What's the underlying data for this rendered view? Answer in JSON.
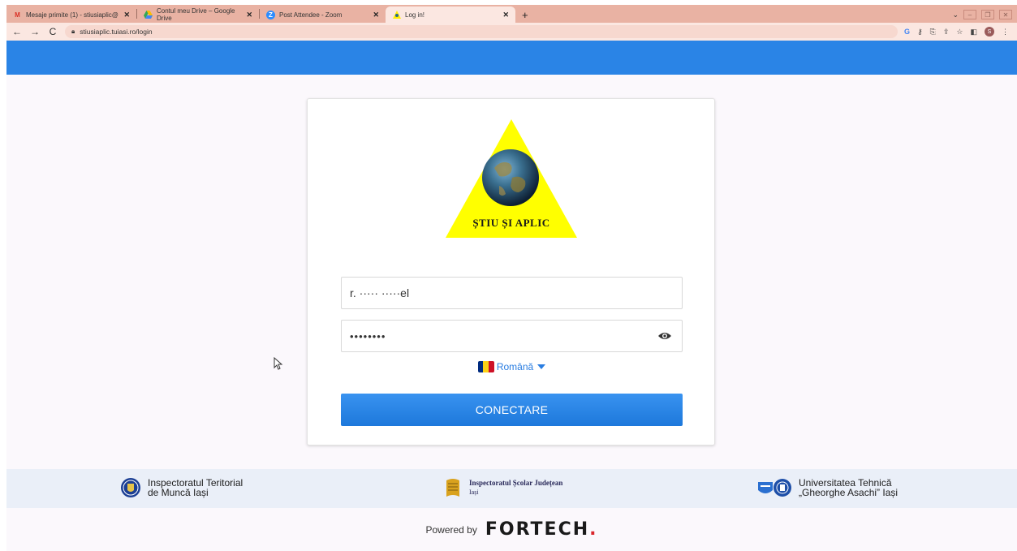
{
  "browser": {
    "tabs": [
      {
        "title": "Mesaje primite (1) - stiusiaplic@",
        "favicon": "gmail-icon"
      },
      {
        "title": "Contul meu Drive – Google Drive",
        "favicon": "drive-icon"
      },
      {
        "title": "Post Attendee - Zoom",
        "favicon": "zoom-icon"
      },
      {
        "title": "Log in!",
        "favicon": "site-icon",
        "active": true
      }
    ],
    "url": "stiusiaplic.tuiasi.ro/login"
  },
  "login": {
    "logo_text": "ȘTIU ȘI APLIC",
    "username_value": "r. ·····  ·····el",
    "password_value": "••••••••",
    "language": "Română",
    "connect_label": "CONECTARE"
  },
  "partners": {
    "itm_line1": "Inspectoratul Teritorial",
    "itm_line2": "de Muncă Iași",
    "isj_line1": "Inspectoratul Școlar Județean",
    "isj_line2": "Iași",
    "tuiasi_line1": "Universitatea Tehnică",
    "tuiasi_line2": "„Gheorghe Asachi” Iași"
  },
  "footer": {
    "powered_by": "Powered by",
    "brand": "FORTECH",
    "brand_dot": "."
  },
  "colors": {
    "header_blue": "#2a84e6",
    "button_blue": "#1d78db",
    "tab_strip": "#e9b2a3",
    "logo_yellow": "#ffff00"
  }
}
